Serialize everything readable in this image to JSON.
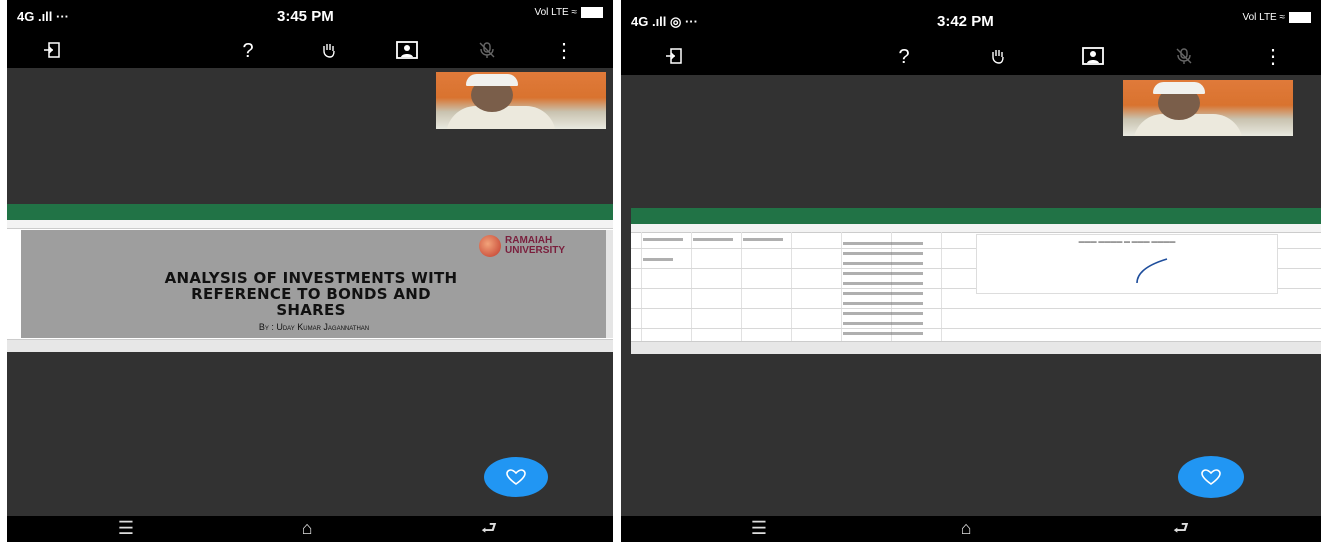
{
  "left": {
    "status": {
      "network": "4G .ıll ···",
      "time": "3:45 PM",
      "right": "Vol LTE ≈"
    },
    "toolbar": {
      "exit": "exit-icon",
      "help": "question-icon",
      "hand": "raise-hand-icon",
      "video": "video-person-icon",
      "mic": "mic-off-icon",
      "more": "more-vertical-icon"
    },
    "slide": {
      "title_line1": "ANALYSIS OF INVESTMENTS WITH",
      "title_line2": "REFERENCE TO BONDS AND",
      "title_line3": "SHARES",
      "byline": "By : Uday Kumar Jagannathan",
      "logo_line1": "RAMAIAH",
      "logo_line2": "UNIVERSITY"
    }
  },
  "right": {
    "status": {
      "network": "4G .ıll ◎ ···",
      "time": "3:42 PM",
      "right": "Vol LTE ≈"
    },
    "toolbar": {
      "exit": "exit-icon",
      "help": "question-icon",
      "hand": "raise-hand-icon",
      "video": "video-person-icon",
      "mic": "mic-off-icon",
      "more": "more-vertical-icon"
    }
  },
  "colors": {
    "accent": "#2196f3",
    "excel_green": "#217346",
    "background": "#323232"
  }
}
